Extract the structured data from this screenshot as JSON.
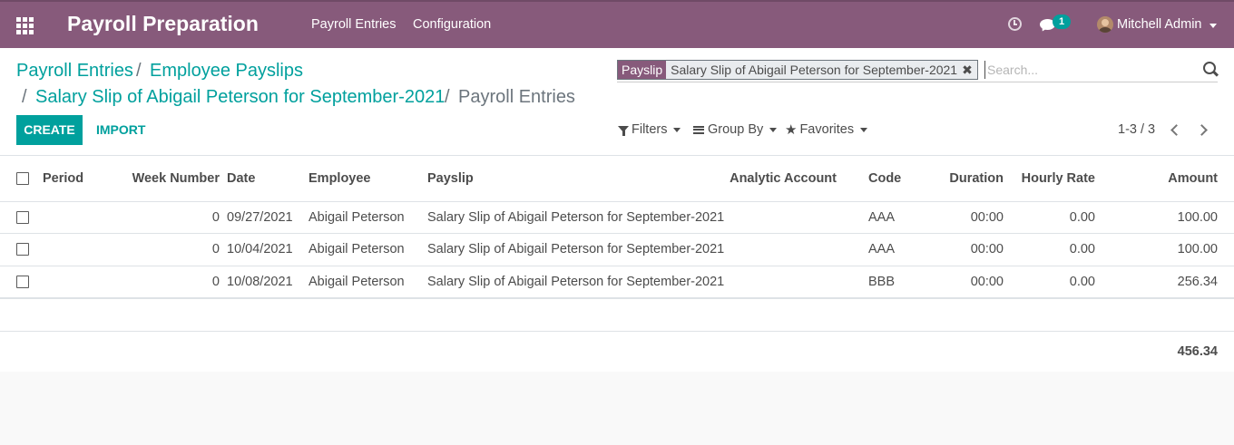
{
  "navbar": {
    "app_title": "Payroll Preparation",
    "menu": [
      "Payroll Entries",
      "Configuration"
    ],
    "chat_badge_count": "1",
    "user_name": "Mitchell Admin",
    "color": "#875a7b"
  },
  "breadcrumbs": {
    "items": [
      "Payroll Entries",
      "Employee Payslips",
      "Salary Slip of Abigail Peterson for September-2021"
    ],
    "active": "Payroll Entries",
    "separator": "/"
  },
  "search": {
    "facet_category": "Payslip",
    "facet_value": "Salary Slip of Abigail Peterson for September-2021",
    "placeholder": "Search..."
  },
  "buttons": {
    "create": "CREATE",
    "import": "IMPORT"
  },
  "filters": {
    "filters_label": "Filters",
    "group_by_label": "Group By",
    "favorites_label": "Favorites"
  },
  "pager": {
    "value": "1-3 / 3"
  },
  "table": {
    "columns": [
      "Period",
      "Week Number",
      "Date",
      "Employee",
      "Payslip",
      "Analytic Account",
      "Code",
      "Duration",
      "Hourly Rate",
      "Amount"
    ],
    "rows": [
      {
        "period": "",
        "week_number": "0",
        "date": "09/27/2021",
        "employee": "Abigail Peterson",
        "payslip": "Salary Slip of Abigail Peterson for September-2021",
        "analytic_account": "",
        "code": "AAA",
        "duration": "00:00",
        "hourly_rate": "0.00",
        "amount": "100.00"
      },
      {
        "period": "",
        "week_number": "0",
        "date": "10/04/2021",
        "employee": "Abigail Peterson",
        "payslip": "Salary Slip of Abigail Peterson for September-2021",
        "analytic_account": "",
        "code": "AAA",
        "duration": "00:00",
        "hourly_rate": "0.00",
        "amount": "100.00"
      },
      {
        "period": "",
        "week_number": "0",
        "date": "10/08/2021",
        "employee": "Abigail Peterson",
        "payslip": "Salary Slip of Abigail Peterson for September-2021",
        "analytic_account": "",
        "code": "BBB",
        "duration": "00:00",
        "hourly_rate": "0.00",
        "amount": "256.34"
      }
    ],
    "total_amount": "456.34"
  },
  "colors": {
    "accent": "#00a09d",
    "brand": "#875a7b"
  }
}
